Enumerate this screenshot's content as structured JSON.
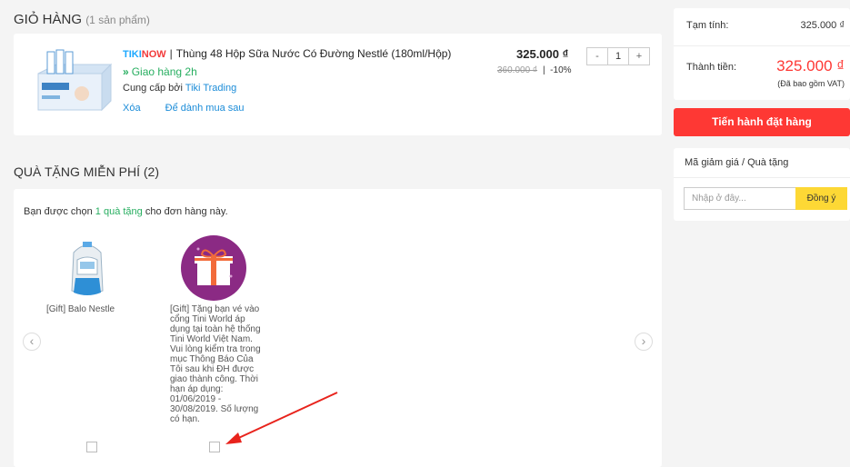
{
  "cart": {
    "title": "GIỎ HÀNG",
    "count_label": "(1 sản phẩm)",
    "item": {
      "badge_tiki": "TIKI",
      "badge_now": "NOW",
      "separator": "|",
      "name": "Thùng 48 Hộp Sữa Nước Có Đường Nestlé (180ml/Hộp)",
      "delivery": "Giao hàng 2h",
      "seller_prefix": "Cung cấp bởi",
      "seller_name": "Tiki Trading",
      "delete_label": "Xóa",
      "save_later_label": "Để dành mua sau",
      "price": "325.000 ₫",
      "old_price": "360.000 ₫",
      "discount_sep": "|",
      "discount": "-10%",
      "qty_minus": "-",
      "qty_value": "1",
      "qty_plus": "+"
    }
  },
  "gifts": {
    "title": "QUÀ TẶNG MIỄN PHÍ (2)",
    "intro_prefix": "Bạn được chọn",
    "intro_highlight": "1 quà tặng",
    "intro_suffix": "cho đơn hàng này.",
    "items": [
      {
        "name": "[Gift] Balo Nestle",
        "icon": "backpack-icon",
        "checked": false
      },
      {
        "name": "[Gift] Tặng bạn vé vào cổng Tini World áp dụng tại toàn hệ thống Tini World Việt Nam. Vui lòng kiểm tra trong mục Thông Báo Của Tôi sau khi ĐH được giao thành công. Thời hạn áp dụng: 01/06/2019 - 30/08/2019. Số lượng có hạn.",
        "icon": "gift-box-icon",
        "checked": false
      }
    ],
    "prev": "‹",
    "next": "›"
  },
  "summary": {
    "subtotal_label": "Tạm tính:",
    "subtotal_value": "325.000 ₫",
    "total_label": "Thành tiền:",
    "total_value": "325.000 ₫",
    "vat_note": "(Đã bao gồm VAT)",
    "checkout_label": "Tiến hành đặt hàng"
  },
  "coupon": {
    "title": "Mã giảm giá / Quà tặng",
    "placeholder": "Nhập ở đây...",
    "apply_label": "Đồng ý"
  },
  "colors": {
    "accent_red": "#fe3834",
    "link_blue": "#1b8cd8",
    "green": "#27ae60",
    "yellow": "#fdd835"
  }
}
